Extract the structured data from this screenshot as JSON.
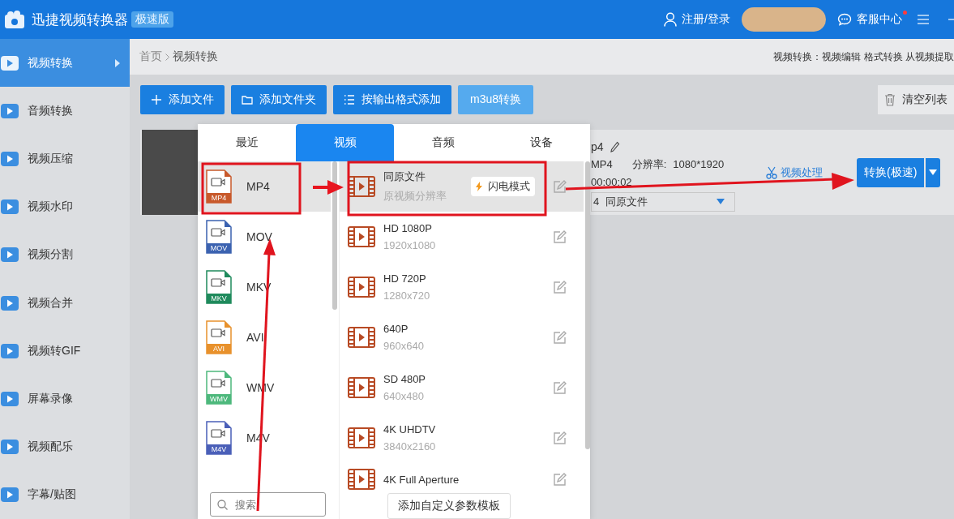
{
  "app": {
    "title": "迅捷视频转换器",
    "edition_badge": "极速版"
  },
  "header": {
    "login": "注册/登录",
    "support": "客服中心",
    "support_notice": true
  },
  "sidebar": {
    "items": [
      {
        "label": "视频转换",
        "selected": true
      },
      {
        "label": "音频转换",
        "selected": false
      },
      {
        "label": "视频压缩",
        "selected": false
      },
      {
        "label": "视频水印",
        "selected": false
      },
      {
        "label": "视频分割",
        "selected": false
      },
      {
        "label": "视频合并",
        "selected": false
      },
      {
        "label": "视频转GIF",
        "selected": false
      },
      {
        "label": "屏幕录像",
        "selected": false
      },
      {
        "label": "视频配乐",
        "selected": false
      },
      {
        "label": "字幕/贴图",
        "selected": false
      }
    ]
  },
  "breadcrumb": {
    "items": [
      "首页",
      "视频转换"
    ],
    "hint": "视频转换：视频编辑 格式转换 从视频提取"
  },
  "toolbar": {
    "buttons": [
      {
        "label": "添加文件",
        "kind": "add"
      },
      {
        "label": "添加文件夹",
        "kind": "folder"
      },
      {
        "label": "按输出格式添加",
        "kind": "list"
      },
      {
        "label": "m3u8转换",
        "kind": "plain"
      }
    ],
    "clear": "清空列表"
  },
  "file": {
    "name": "p4",
    "format": "MP4",
    "resolution_label": "分辨率:",
    "resolution": "1080*1920",
    "duration": "00:00:02",
    "output_format": "4",
    "output_preset": "同原文件",
    "process": "视频处理",
    "convert": "转换(极速)"
  },
  "popup": {
    "tabs": [
      {
        "label": "最近",
        "selected": false
      },
      {
        "label": "视频",
        "selected": true
      },
      {
        "label": "音频",
        "selected": false
      },
      {
        "label": "设备",
        "selected": false
      }
    ],
    "formats": [
      {
        "name": "MP4",
        "tag": "MP4",
        "color": "#c8592b",
        "selected": true
      },
      {
        "name": "MOV",
        "tag": "MOV",
        "color": "#3b62b0",
        "selected": false
      },
      {
        "name": "MKV",
        "tag": "MKV",
        "color": "#1f8a5c",
        "selected": false
      },
      {
        "name": "AVI",
        "tag": "AVI",
        "color": "#e8912c",
        "selected": false
      },
      {
        "name": "WMV",
        "tag": "WMV",
        "color": "#4db87c",
        "selected": false
      },
      {
        "name": "M4V",
        "tag": "M4V",
        "color": "#4a5fb8",
        "selected": false
      }
    ],
    "presets": [
      {
        "title": "同原文件",
        "subtitle": "原视频分辨率",
        "badge": "闪电模式",
        "selected": true
      },
      {
        "title": "HD 1080P",
        "subtitle": "1920x1080",
        "selected": false
      },
      {
        "title": "HD 720P",
        "subtitle": "1280x720",
        "selected": false
      },
      {
        "title": "640P",
        "subtitle": "960x640",
        "selected": false
      },
      {
        "title": "SD 480P",
        "subtitle": "640x480",
        "selected": false
      },
      {
        "title": "4K UHDTV",
        "subtitle": "3840x2160",
        "selected": false
      },
      {
        "title": "4K Full Aperture",
        "selected": false
      }
    ],
    "search_placeholder": "搜索",
    "add_template": "添加自定义参数模板"
  }
}
